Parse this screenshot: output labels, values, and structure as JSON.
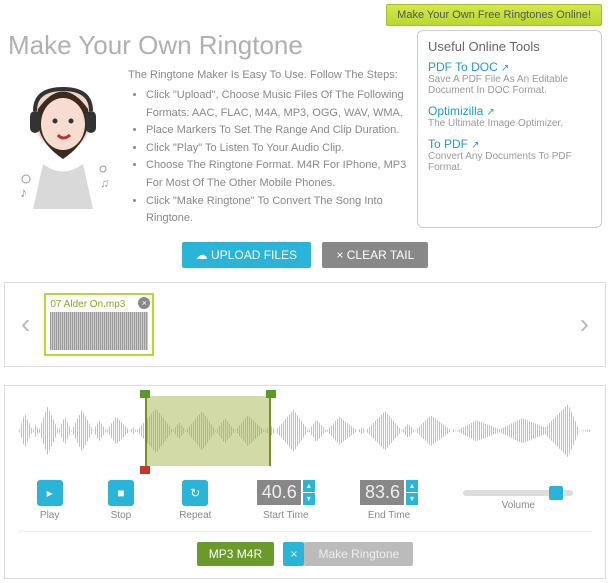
{
  "banner": {
    "cta": "Make Your Own Free Ringtones Online!"
  },
  "title": "Make Your Own Ringtone",
  "intro": {
    "lead": "The Ringtone Maker Is Easy To Use. Follow The Steps:",
    "steps": [
      "Click \"Upload\", Choose Music Files Of The Following Formats: AAC, FLAC, M4A, MP3, OGG, WAV, WMA.",
      "Place Markers To Set The Range And Clip Duration.",
      "Click \"Play\" To Listen To Your Audio Clip.",
      "Choose The Ringtone Format. M4R For IPhone, MP3 For Most Of The Other Mobile Phones.",
      "Click \"Make Ringtone\" To Convert The Song Into Ringtone."
    ]
  },
  "sidebar": {
    "heading": "Useful Online Tools",
    "tools": [
      {
        "name": "PDF To DOC",
        "desc": "Save A PDF File As An Editable Document In DOC Format."
      },
      {
        "name": "Optimizilla",
        "desc": "The Ultimate Image Optimizer."
      },
      {
        "name": "To PDF",
        "desc": "Convert Any Documents To PDF Format."
      }
    ]
  },
  "buttons": {
    "upload": "UPLOAD FILES",
    "clear": "CLEAR TAIL"
  },
  "file": {
    "name": "07 Alder On.mp3"
  },
  "controls": {
    "play": "Play",
    "stop": "Stop",
    "repeat": "Repeat",
    "start_label": "Start Time",
    "start_value": "40.6",
    "end_label": "End Time",
    "end_value": "83.6",
    "volume": "Volume"
  },
  "bottom": {
    "format": "MP3 M4R",
    "make": "Make Ringtone"
  }
}
